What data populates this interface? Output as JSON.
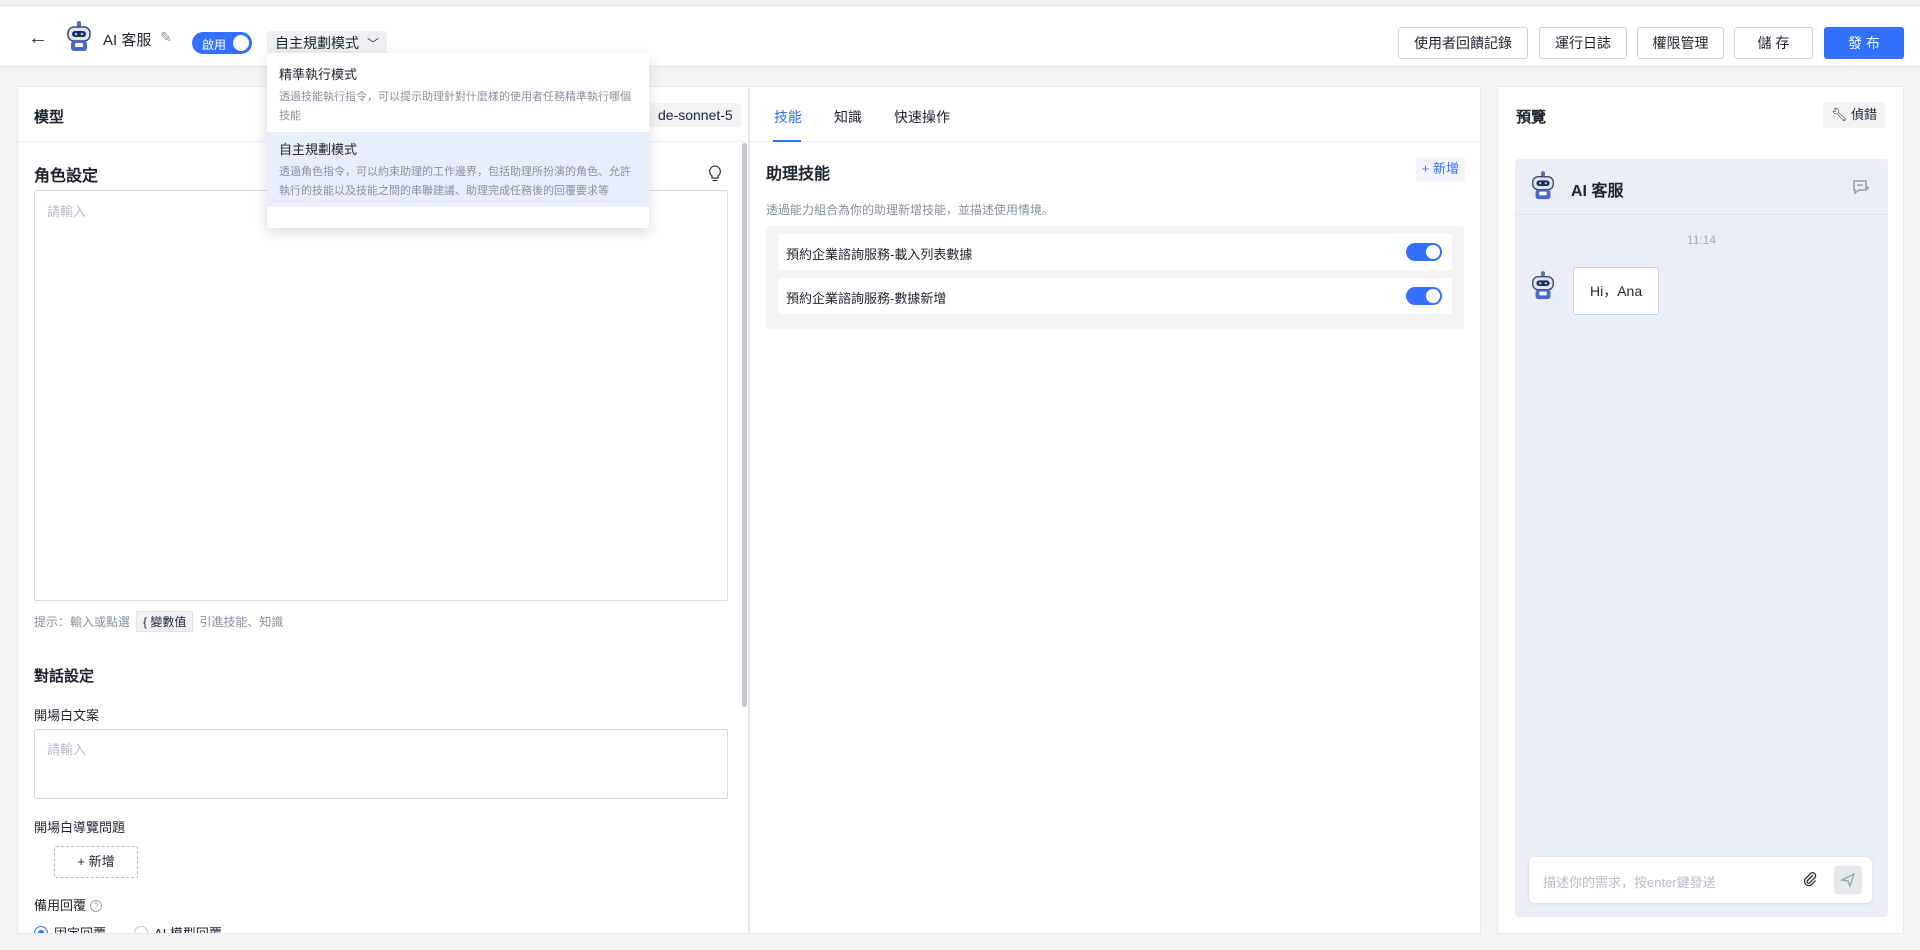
{
  "topbar": {
    "title": "AI 客服",
    "enable_label": "啟用",
    "mode_selected": "自主規劃模式",
    "buttons": {
      "feedback": "使用者回饋記錄",
      "logs": "運行日誌",
      "permissions": "權限管理",
      "save": "儲 存",
      "publish": "發 布"
    }
  },
  "mode_dropdown": {
    "options": [
      {
        "title": "精準執行模式",
        "desc": "透過技能執行指令，可以提示助理針對什麼樣的使用者任務精準執行哪個技能"
      },
      {
        "title": "自主規劃模式",
        "desc": "透過角色指令，可以約束助理的工作邊界，包括助理所扮演的角色、允許執行的技能以及技能之間的串聯建議、助理完成任務後的回覆要求等"
      }
    ]
  },
  "left": {
    "model_label": "模型",
    "model_value": "de-sonnet-5",
    "role_title": "角色設定",
    "role_placeholder": "請輸入",
    "hint_prefix": "提示：輸入或點選",
    "hint_chip": "{ 變數值",
    "hint_suffix": "引進技能、知識",
    "dialog_title": "對話設定",
    "opening_label": "開場白文案",
    "opening_placeholder": "請輸入",
    "guide_label": "開場白導覽問題",
    "add_label": "+ 新增",
    "fallback_label": "備用回覆",
    "radio_fixed": "固定回覆",
    "radio_ai": "AI 模型回覆"
  },
  "middle": {
    "tabs": [
      "技能",
      "知識",
      "快速操作"
    ],
    "section_title": "助理技能",
    "add_label": "+ 新增",
    "desc": "透過能力組合為你的助理新增技能，並描述使用情境。",
    "skills": [
      {
        "name": "預約企業諮詢服務-載入列表數據",
        "enabled": true
      },
      {
        "name": "預約企業諮詢服務-數據新增",
        "enabled": true
      }
    ]
  },
  "preview": {
    "title": "預覽",
    "debug_label": "偵錯",
    "bot_name": "AI 客服",
    "time": "11:14",
    "message": "Hi，Ana",
    "input_placeholder": "描述你的需求，按enter鍵發送"
  },
  "colors": {
    "accent": "#3370ff"
  }
}
